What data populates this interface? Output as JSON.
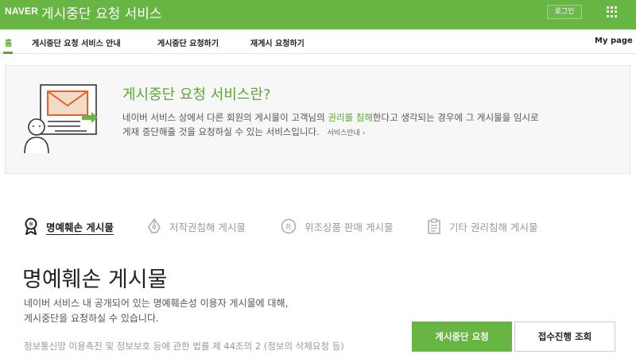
{
  "header": {
    "brand": "NAVER",
    "title": "게시중단 요청 서비스",
    "login_label": "로그인",
    "apps_icon": "grid-icon"
  },
  "nav": {
    "items": [
      {
        "label": "홈"
      },
      {
        "label": "게시중단 요청 서비스 안내"
      },
      {
        "label": "게시중단 요청하기"
      },
      {
        "label": "재게시 요청하기"
      }
    ],
    "mypage": "My page",
    "active_color": "#58a832"
  },
  "intro": {
    "title": "게시중단 요청 서비스란?",
    "desc_before": "네이버 서비스 상에서 다른 회원의 게시물이 고객님의 ",
    "desc_highlight": "권리를 침해",
    "desc_after": "한다고 생각되는 경우에 그 게시물을 임시로",
    "desc_line2": "게재 중단해줄 것을 요청하실 수 있는 서비스입니다.",
    "link_label": "서비스안내 ›"
  },
  "tabs": [
    {
      "label": "명예훼손 게시물",
      "icon": "ribbon-icon",
      "active": true
    },
    {
      "label": "저작권침해 게시물",
      "icon": "pen-nib-icon",
      "active": false
    },
    {
      "label": "위조상품 판매 게시물",
      "icon": "registered-icon",
      "active": false
    },
    {
      "label": "기타 권리침해 게시물",
      "icon": "clipboard-icon",
      "active": false
    }
  ],
  "section": {
    "title": "명예훼손 게시물",
    "desc_line1": "네이버 서비스 내 공개되어 있는 명예훼손성 이용자 게시물에 대해,",
    "desc_line2": "게시중단을 요청하실 수 있습니다.",
    "law": "정보통신망 이용촉진 및 정보보호 등에 관한 법률 제 44조의 2 (정보의 삭제요청 등)"
  },
  "buttons": {
    "request": "게시중단 요청",
    "status": "접수진행 조회"
  },
  "colors": {
    "brand_green": "#67b543",
    "accent_green": "#58a832",
    "illustration_orange": "#e8602c"
  }
}
